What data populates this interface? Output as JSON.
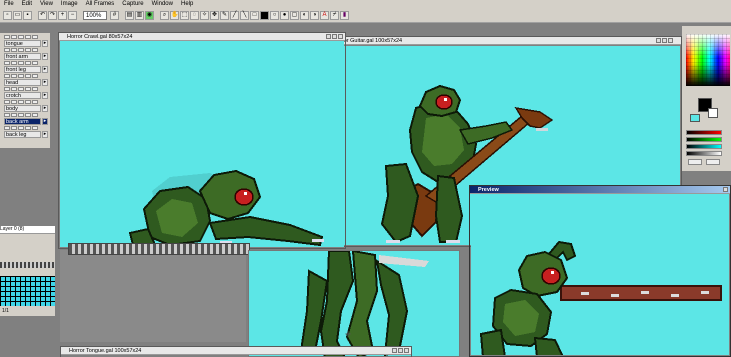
{
  "menu": [
    "File",
    "Edit",
    "View",
    "Image",
    "All Frames",
    "Capture",
    "Window",
    "Help"
  ],
  "toolbar": {
    "zoom": "100%",
    "tools": [
      "new",
      "open",
      "save",
      "undo",
      "redo",
      "zoom-in",
      "zoom-out",
      "grid",
      "magnify",
      "select-rect",
      "select-lasso",
      "move",
      "pen",
      "brush",
      "eraser",
      "fill",
      "line",
      "rect",
      "ellipse",
      "text",
      "color-picker",
      "stamp"
    ]
  },
  "layers": [
    {
      "name": "tongue",
      "selected": false
    },
    {
      "name": "front arm",
      "selected": false
    },
    {
      "name": "front leg",
      "selected": false
    },
    {
      "name": "head",
      "selected": false
    },
    {
      "name": "crotch",
      "selected": false
    },
    {
      "name": "body",
      "selected": false
    },
    {
      "name": "back arm",
      "selected": true
    },
    {
      "name": "back leg",
      "selected": false
    }
  ],
  "frame_panel": {
    "title": "Layer 0 (8)",
    "footer": "1/1"
  },
  "windows": {
    "crawl": {
      "title": "Horror Crawl.gal 80x57x24"
    },
    "guitar": {
      "title": "Horror Guitar.gal 100x57x24"
    },
    "preview": {
      "title": "Preview"
    },
    "tongue": {
      "title": "Horror Tongue.gal 100x57x24"
    }
  },
  "colors": {
    "canvas": "#5ce6e6",
    "primary": "#000000",
    "secondary": "#ffffff",
    "accent": "#5ce6e6",
    "title_active": "#0a246a"
  }
}
